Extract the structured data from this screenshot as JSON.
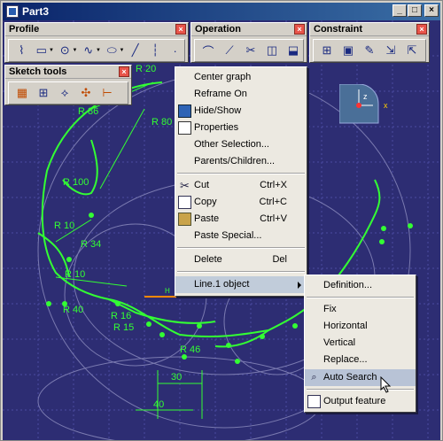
{
  "window": {
    "title": "Part3"
  },
  "toolbars": {
    "profile": {
      "title": "Profile"
    },
    "operation": {
      "title": "Operation"
    },
    "constraint": {
      "title": "Constraint"
    },
    "sketch_tools": {
      "title": "Sketch tools"
    }
  },
  "canvas": {
    "dimension_labels": [
      "R 86",
      "R 80",
      "R 100",
      "R 10",
      "R 34",
      "R 40",
      "R 16",
      "R 15",
      "R 46",
      "30",
      "40",
      "R 10",
      "R 20"
    ],
    "axis_label": "H",
    "compass_labels": {
      "z": "z",
      "x": "x"
    }
  },
  "context_menu": {
    "items": [
      {
        "label": "Center graph",
        "shortcut": ""
      },
      {
        "label": "Reframe On",
        "shortcut": ""
      },
      {
        "label": "Hide/Show",
        "shortcut": ""
      },
      {
        "label": "Properties",
        "shortcut": ""
      },
      {
        "label": "Other Selection...",
        "shortcut": ""
      },
      {
        "label": "Parents/Children...",
        "shortcut": ""
      },
      {
        "label": "Cut",
        "shortcut": "Ctrl+X"
      },
      {
        "label": "Copy",
        "shortcut": "Ctrl+C"
      },
      {
        "label": "Paste",
        "shortcut": "Ctrl+V"
      },
      {
        "label": "Paste Special...",
        "shortcut": ""
      },
      {
        "label": "Delete",
        "shortcut": "Del"
      },
      {
        "label": "Line.1 object",
        "shortcut": ""
      }
    ]
  },
  "submenu": {
    "items": [
      {
        "label": "Definition..."
      },
      {
        "label": "Fix"
      },
      {
        "label": "Horizontal"
      },
      {
        "label": "Vertical"
      },
      {
        "label": "Replace..."
      },
      {
        "label": "Auto Search"
      },
      {
        "label": "Output feature"
      }
    ]
  },
  "colors": {
    "canvas_bg": "#2d2d73",
    "sketch_green": "#33ff33",
    "menu_bg": "#ece9e1",
    "highlight": "#b8c3d6",
    "title_bar": "#0a246a"
  }
}
